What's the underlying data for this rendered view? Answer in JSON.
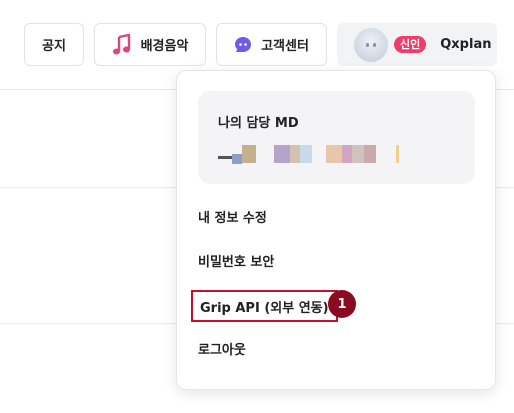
{
  "header": {
    "notice_label": "공지",
    "music_label": "배경음악",
    "support_label": "고객센터",
    "profile": {
      "badge": "신인",
      "name": "Qxplan"
    }
  },
  "icons": {
    "music": "music-note-icon",
    "support": "chat-bubble-icon",
    "avatar": "user-avatar"
  },
  "colors": {
    "music_icon": "#e0447d",
    "support_icon": "#6c5ce7",
    "badge": "#ee3d6b",
    "highlight_box": "#c8102e",
    "step_marker": "#8b0a1f"
  },
  "dropdown": {
    "manager_title": "나의 담당 MD",
    "menu": [
      {
        "label": "내 정보 수정"
      },
      {
        "label": "비밀번호 보안"
      },
      {
        "label": "Grip API (외부 연동)"
      },
      {
        "label": "로그아웃"
      }
    ]
  },
  "annotation": {
    "step": "1"
  }
}
